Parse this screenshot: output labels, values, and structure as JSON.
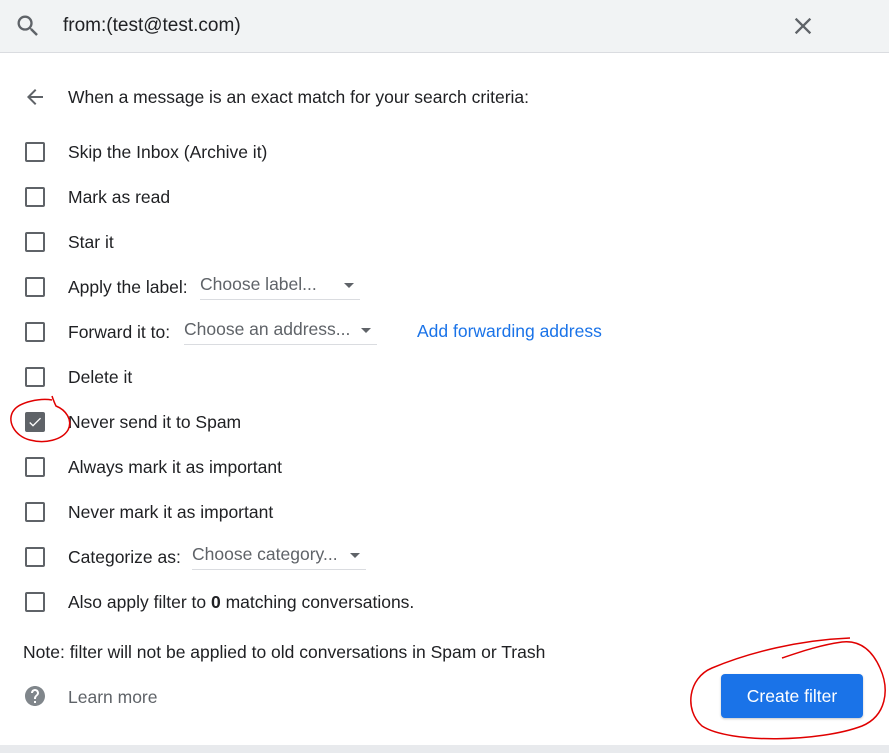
{
  "search": {
    "query": "from:(test@test.com)",
    "search_icon": "search-icon",
    "close_icon": "close-icon"
  },
  "header": {
    "back_icon": "arrow-back-icon",
    "text": "When a message is an exact match for your search criteria:"
  },
  "options": [
    {
      "label": "Skip the Inbox (Archive it)",
      "checked": false
    },
    {
      "label": "Mark as read",
      "checked": false
    },
    {
      "label": "Star it",
      "checked": false
    },
    {
      "label": "Apply the label:",
      "checked": false,
      "dropdown": "Choose label..."
    },
    {
      "label": "Forward it to:",
      "checked": false,
      "dropdown": "Choose an address...",
      "link": "Add forwarding address"
    },
    {
      "label": "Delete it",
      "checked": false
    },
    {
      "label": "Never send it to Spam",
      "checked": true
    },
    {
      "label": "Always mark it as important",
      "checked": false
    },
    {
      "label": "Never mark it as important",
      "checked": false
    },
    {
      "label": "Categorize as:",
      "checked": false,
      "dropdown": "Choose category..."
    },
    {
      "label_prefix": "Also apply filter to ",
      "count": "0",
      "label_suffix": " matching conversations.",
      "checked": false
    }
  ],
  "note": "Note: filter will not be applied to old conversations in Spam or Trash",
  "footer": {
    "help_icon": "help-icon",
    "learn_more": "Learn more",
    "create_filter": "Create filter"
  },
  "colors": {
    "accent": "#1a73e8",
    "annotation": "#e00000",
    "checkbox": "#5f6368"
  }
}
